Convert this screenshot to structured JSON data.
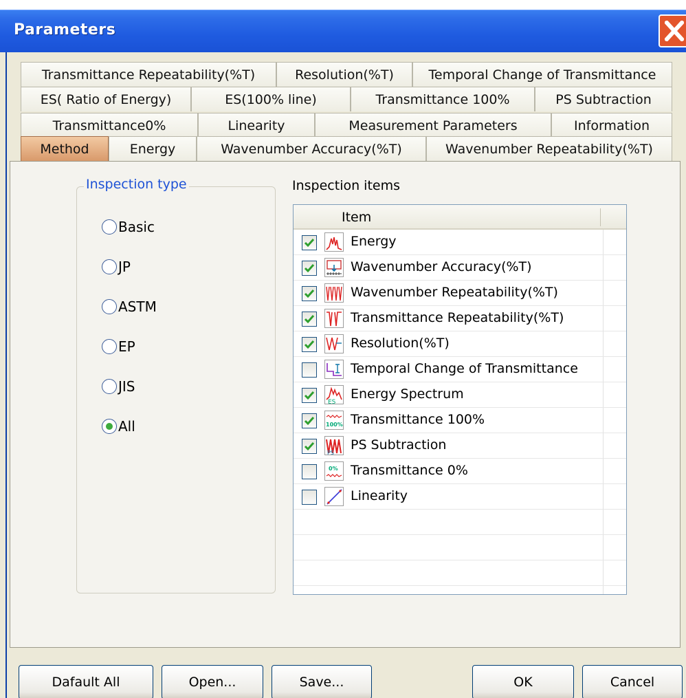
{
  "window": {
    "title": "Parameters"
  },
  "tabs": {
    "row1": [
      "Transmittance Repeatability(%T)",
      "Resolution(%T)",
      "Temporal Change of Transmittance"
    ],
    "row2": [
      "ES( Ratio of Energy)",
      "ES(100% line)",
      "Transmittance 100%",
      "PS Subtraction"
    ],
    "row3": [
      "Transmittance0%",
      "Linearity",
      "Measurement Parameters",
      "Information"
    ],
    "row4": [
      "Method",
      "Energy",
      "Wavenumber Accuracy(%T)",
      "Wavenumber Repeatability(%T)"
    ],
    "active": "Method"
  },
  "inspection_type": {
    "label": "Inspection type",
    "options": [
      "Basic",
      "JP",
      "ASTM",
      "EP",
      "JIS",
      "All"
    ],
    "selected": "All"
  },
  "inspection_items": {
    "label": "Inspection items",
    "column_header": "Item",
    "items": [
      {
        "label": "Energy",
        "checked": true,
        "icon": "energy-icon"
      },
      {
        "label": "Wavenumber Accuracy(%T)",
        "checked": true,
        "icon": "wavenumber-accuracy-icon"
      },
      {
        "label": "Wavenumber Repeatability(%T)",
        "checked": true,
        "icon": "wavenumber-repeatability-icon"
      },
      {
        "label": "Transmittance Repeatability(%T)",
        "checked": true,
        "icon": "transmittance-repeatability-icon"
      },
      {
        "label": "Resolution(%T)",
        "checked": true,
        "icon": "resolution-icon"
      },
      {
        "label": "Temporal Change of Transmittance",
        "checked": false,
        "icon": "temporal-change-icon"
      },
      {
        "label": "Energy Spectrum",
        "checked": true,
        "icon": "energy-spectrum-icon"
      },
      {
        "label": "Transmittance 100%",
        "checked": true,
        "icon": "transmittance-100-icon"
      },
      {
        "label": "PS Subtraction",
        "checked": true,
        "icon": "ps-subtraction-icon"
      },
      {
        "label": "Transmittance 0%",
        "checked": false,
        "icon": "transmittance-0-icon"
      },
      {
        "label": "Linearity",
        "checked": false,
        "icon": "linearity-icon"
      }
    ]
  },
  "buttons": {
    "default_all": "Dafault All",
    "open": "Open...",
    "save": "Save...",
    "ok": "OK",
    "cancel": "Cancel"
  },
  "colors": {
    "titlebar": "#2d6ce8",
    "active_tab": "#e0a878",
    "group_title": "#1e52d6",
    "check": "#2e9f2e"
  }
}
